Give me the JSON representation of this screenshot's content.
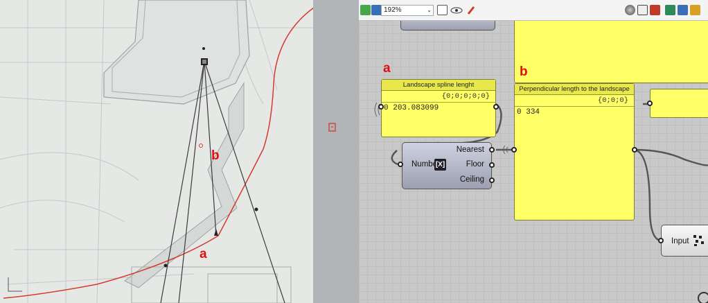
{
  "viewport": {
    "label_a": "a",
    "label_b": "b"
  },
  "toolbar": {
    "zoom_value": "192%",
    "zoom_arrow": "⌄"
  },
  "canvas": {
    "label_a": "a",
    "label_b": "b",
    "panel_spline": {
      "title": "Landscape spline lenght",
      "path": "{0;0;0;0;0}",
      "index": "0",
      "value": "203.083099"
    },
    "panel_perp": {
      "title": "Perpendicular length to the landscape",
      "path": "{0;0;0}",
      "index": "0",
      "value": "334"
    },
    "round": {
      "input": "Number",
      "icon": "[X]",
      "out_nearest": "Nearest",
      "out_floor": "Floor",
      "out_ceiling": "Ceiling"
    },
    "input_comp": {
      "label": "Input"
    }
  },
  "colors": {
    "panel_fill": "#ffff66",
    "panel_header": "#e8e84a",
    "curve_red": "#d23a2a",
    "label_red": "#e01010",
    "canvas_bg": "#c9c9c9"
  },
  "icons": [
    "new-file-icon",
    "save-icon",
    "zoom-extents-icon",
    "eye-icon",
    "paint-icon",
    "sphere-preview-icon",
    "wire-preview-icon",
    "shaded-preview-icon",
    "selected-preview-icon"
  ]
}
